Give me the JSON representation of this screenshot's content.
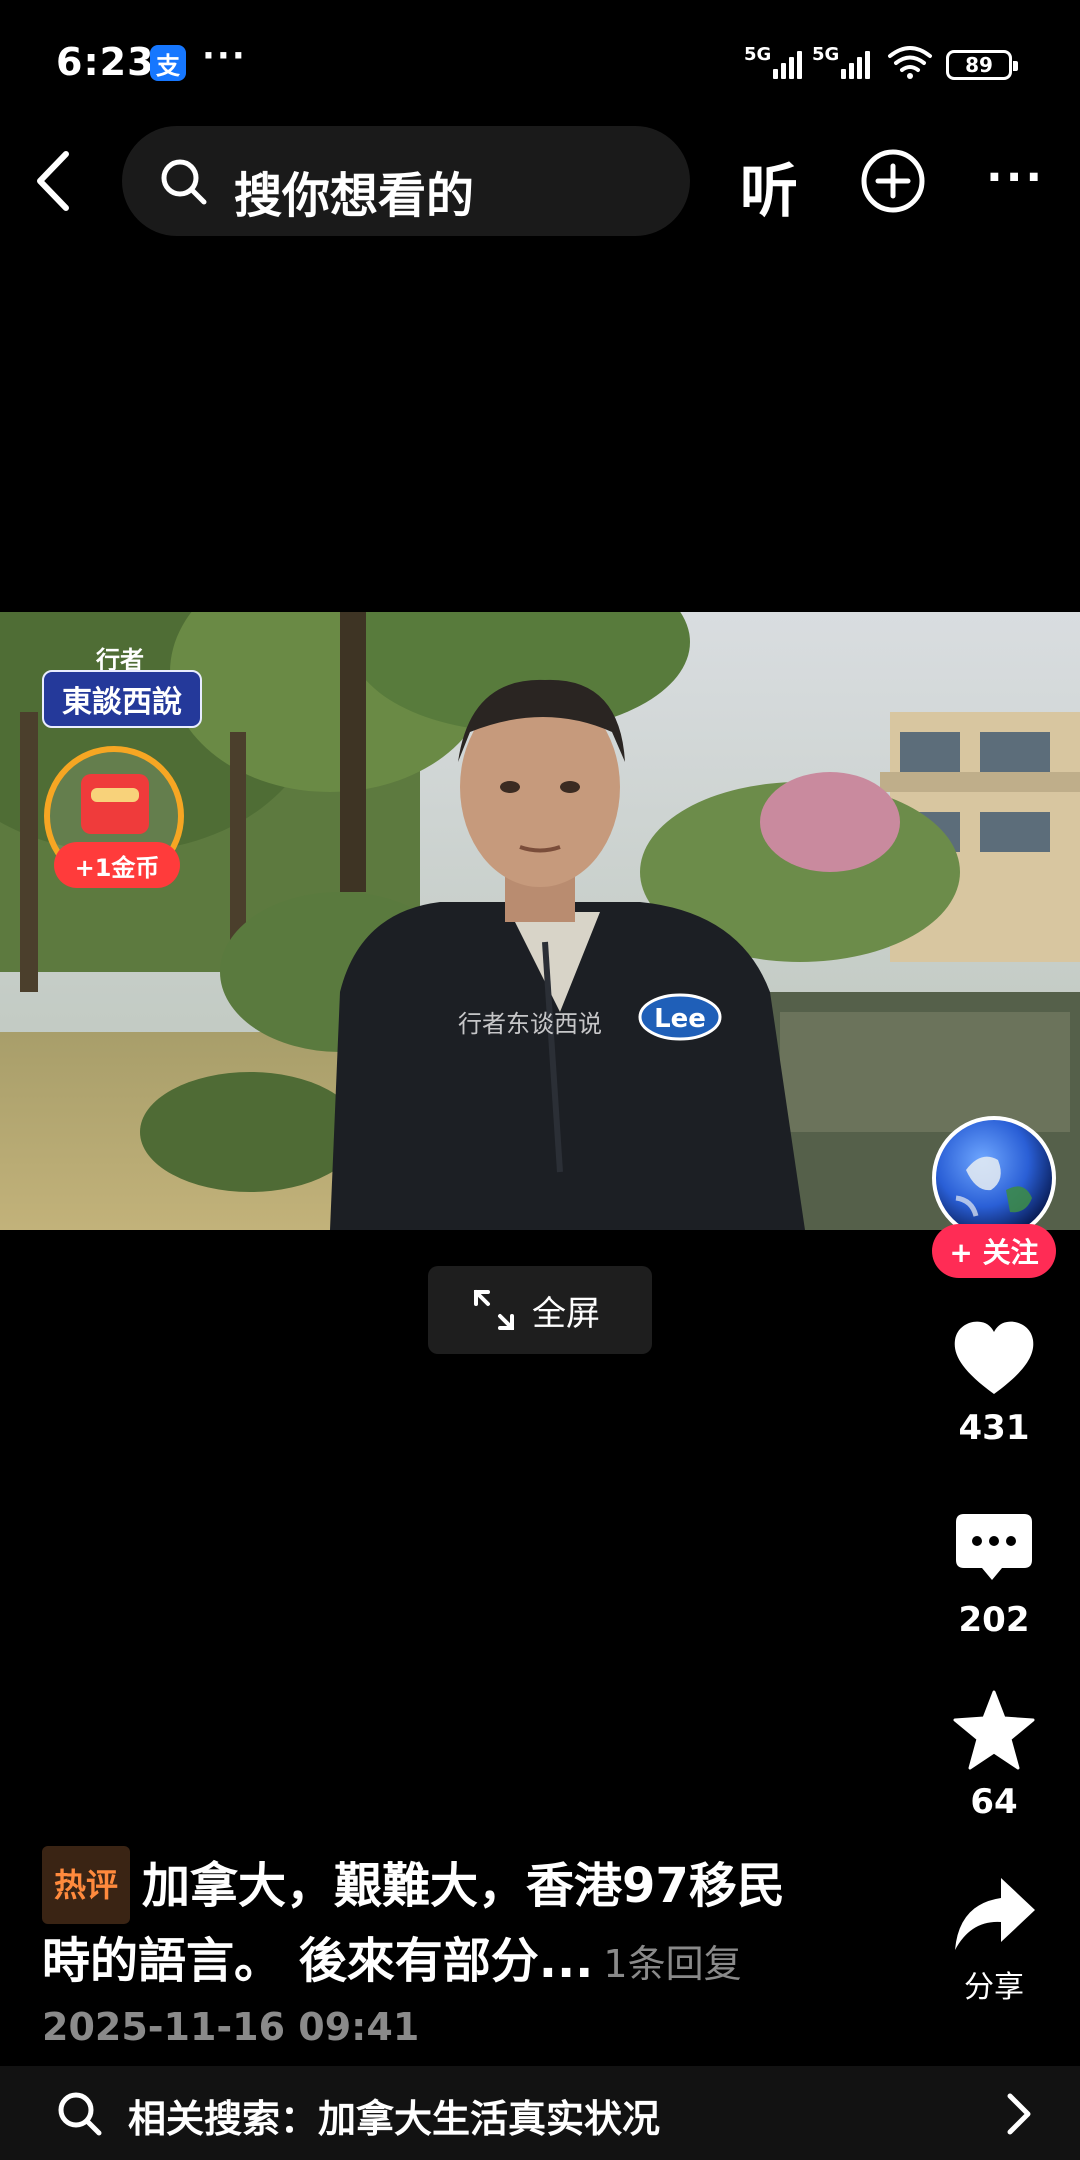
{
  "status_bar": {
    "time": "6:23",
    "app_badge": "支",
    "more": "···",
    "network1": "5G",
    "network2": "5G",
    "battery": "89"
  },
  "top_bar": {
    "search_placeholder": "搜你想看的",
    "listen_label": "听",
    "more_label": "···"
  },
  "video": {
    "channel_logo_top": "行者",
    "channel_logo": "東談西說",
    "coin_label": "+1金币",
    "watermark": "行者东谈西说",
    "fullscreen_label": "全屏"
  },
  "actions": {
    "follow_label": "+ 关注",
    "like_count": "431",
    "comment_count": "202",
    "favorite_count": "64",
    "share_label": "分享"
  },
  "caption": {
    "hot_tag": "热评",
    "line1": "加拿大，艱難大，香港97移民",
    "line2": "時的語言。 後來有部分...",
    "reply_count": "1条回复",
    "date": "2025-11-16 09:41"
  },
  "related_search": {
    "text": "相关搜索：加拿大生活真实状况"
  },
  "colors": {
    "background": "#000000",
    "follow": "#ff2c55",
    "hot_tag": "#ff8a3d",
    "coin_ring": "#f6a623",
    "alipay": "#1677ff"
  },
  "icons": [
    "back-icon",
    "search-icon",
    "add-icon",
    "heart-icon",
    "comment-icon",
    "star-icon",
    "share-icon",
    "fullscreen-icon",
    "chevron-right-icon"
  ]
}
